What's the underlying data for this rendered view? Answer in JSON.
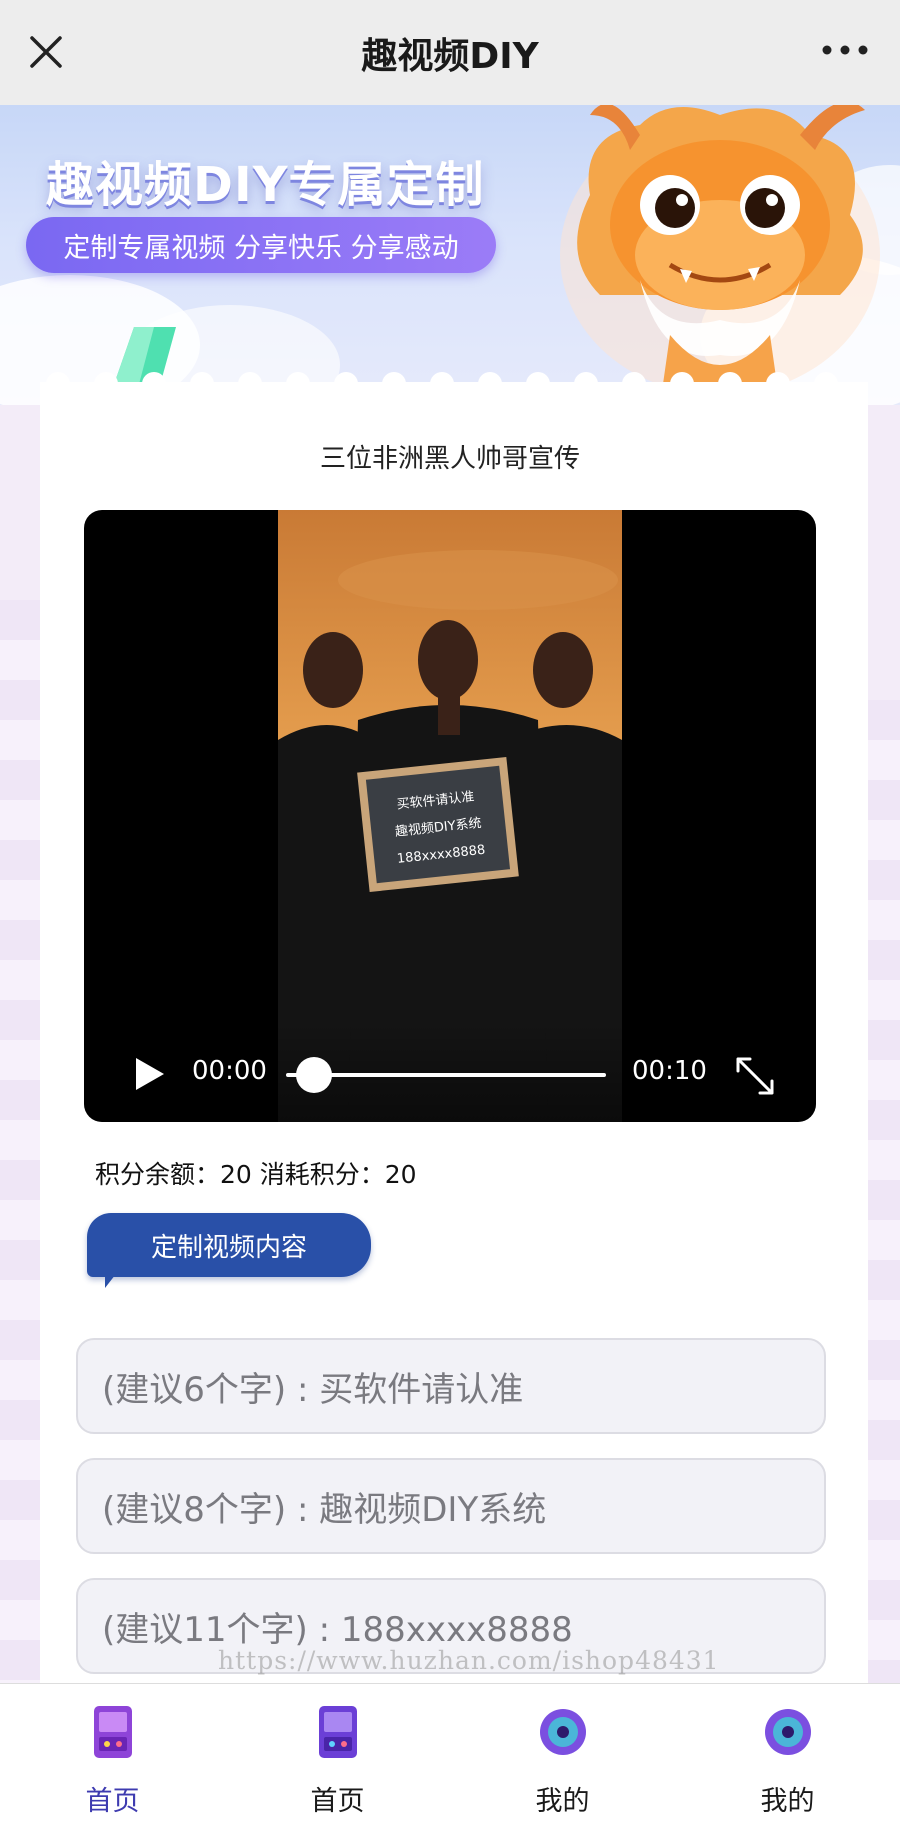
{
  "header": {
    "title": "趣视频DIY",
    "close_icon": "close-icon",
    "more_icon": "more-dots-icon"
  },
  "banner": {
    "title": "趣视频DIY专属定制",
    "subtitle": "定制专属视频 分享快乐 分享感动"
  },
  "video": {
    "title": "三位非洲黑人帅哥宣传",
    "sign_lines": [
      "买软件请认准",
      "趣视频DIY系统",
      "188xxxx8888"
    ],
    "current_time": "00:00",
    "duration": "00:10",
    "progress": 0
  },
  "points": {
    "balance_label": "积分余额：",
    "balance_value": "20",
    "cost_label": " 消耗积分：",
    "cost_value": "20"
  },
  "section": {
    "label": "定制视频内容"
  },
  "inputs": [
    {
      "placeholder": "(建议6个字) : 买软件请认准"
    },
    {
      "placeholder": "(建议8个字) : 趣视频DIY系统"
    },
    {
      "placeholder": "(建议11个字) : 188xxxx8888"
    }
  ],
  "watermark": "https://www.huzhan.com/ishop48431",
  "tabbar": [
    {
      "label": "首页",
      "icon": "arcade-icon",
      "active": true
    },
    {
      "label": "首页",
      "icon": "arcade-icon",
      "active": false
    },
    {
      "label": "我的",
      "icon": "disc-icon",
      "active": false
    },
    {
      "label": "我的",
      "icon": "disc-icon",
      "active": false
    }
  ],
  "colors": {
    "accent": "#3e3bb0",
    "pill": "#7a68f2",
    "chip": "#2950a8"
  }
}
